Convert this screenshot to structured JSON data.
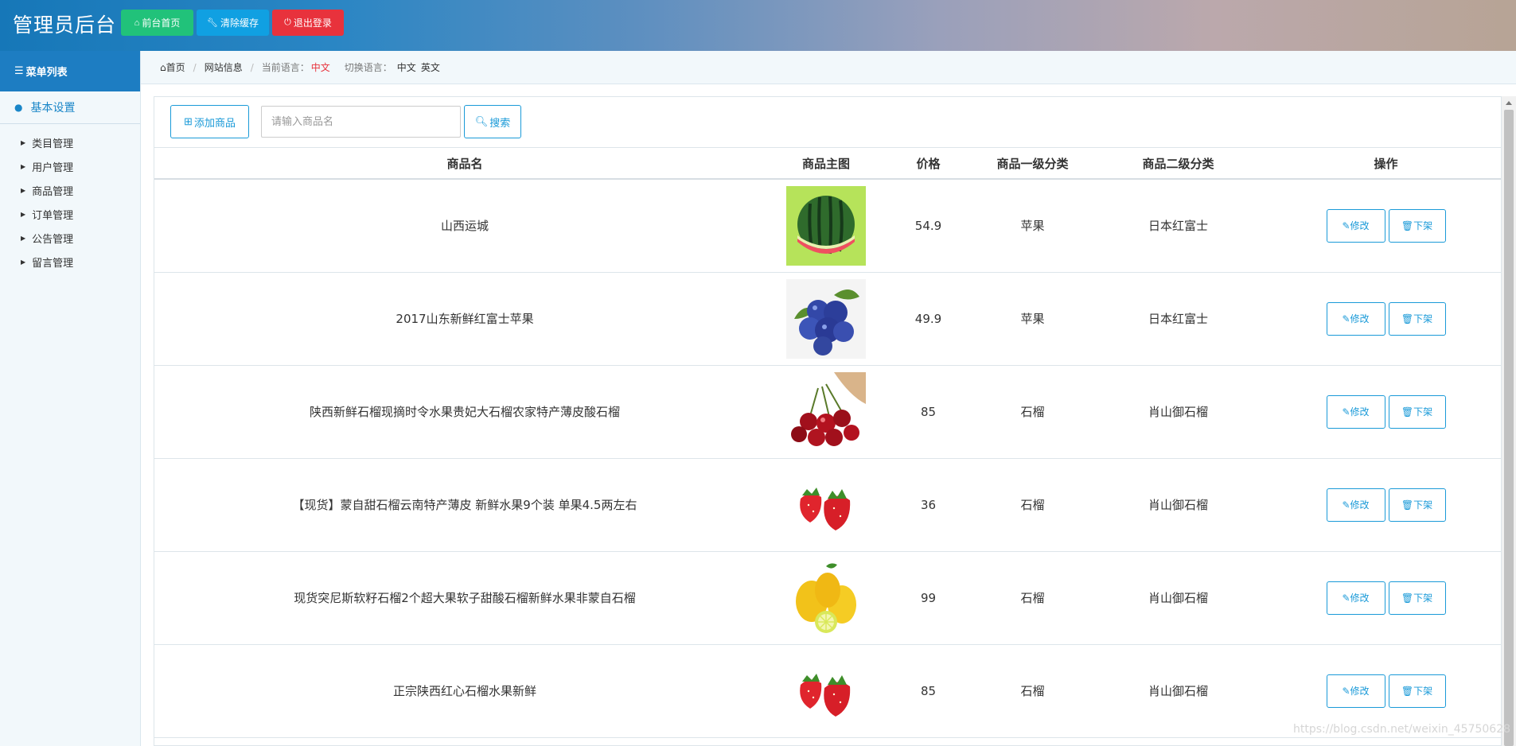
{
  "header": {
    "title": "管理员后台",
    "buttons": [
      {
        "label": "前台首页",
        "icon": "home-icon"
      },
      {
        "label": "清除缓存",
        "icon": "wrench-icon"
      },
      {
        "label": "退出登录",
        "icon": "power-icon"
      }
    ],
    "colors": {
      "home": "#21c27a",
      "clear": "#10a0e2",
      "logout": "#e8323c"
    }
  },
  "sidebar": {
    "title": "菜单列表",
    "group": "基本设置",
    "items": [
      "类目管理",
      "用户管理",
      "商品管理",
      "订单管理",
      "公告管理",
      "留言管理"
    ]
  },
  "breadcrumb": {
    "home": "首页",
    "site_info": "网站信息",
    "current_lang_label": "当前语言：",
    "current_lang": "中文",
    "switch_label": "切换语言：",
    "lang_zh": "中文",
    "lang_en": "英文"
  },
  "toolbar": {
    "add_label": "添加商品",
    "search_placeholder": "请输入商品名",
    "search_label": "搜索"
  },
  "table": {
    "columns": [
      "商品名",
      "商品主图",
      "价格",
      "商品一级分类",
      "商品二级分类",
      "操作"
    ],
    "edit_label": "修改",
    "off_label": "下架",
    "rows": [
      {
        "name": "山西运城",
        "image": "watermelon",
        "price": "54.9",
        "cat1": "苹果",
        "cat2": "日本红富士"
      },
      {
        "name": "2017山东新鲜红富士苹果",
        "image": "blueberries",
        "price": "49.9",
        "cat1": "苹果",
        "cat2": "日本红富士"
      },
      {
        "name": "陕西新鲜石榴现摘时令水果贵妃大石榴农家特产薄皮酸石榴",
        "image": "cherries",
        "price": "85",
        "cat1": "石榴",
        "cat2": "肖山御石榴"
      },
      {
        "name": "【现货】蒙自甜石榴云南特产薄皮 新鲜水果9个装 单果4.5两左右",
        "image": "strawberries",
        "price": "36",
        "cat1": "石榴",
        "cat2": "肖山御石榴"
      },
      {
        "name": "现货突尼斯软籽石榴2个超大果软子甜酸石榴新鲜水果非蒙自石榴",
        "image": "lemons",
        "price": "99",
        "cat1": "石榴",
        "cat2": "肖山御石榴"
      },
      {
        "name": "正宗陕西红心石榴水果新鲜",
        "image": "strawberries",
        "price": "85",
        "cat1": "石榴",
        "cat2": "肖山御石榴"
      }
    ]
  },
  "watermark": "https://blog.csdn.net/weixin_45750628"
}
